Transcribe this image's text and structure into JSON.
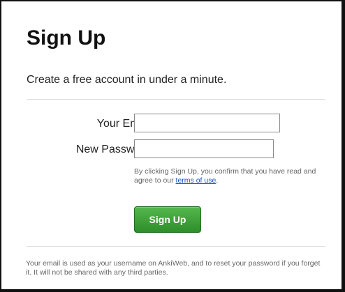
{
  "page": {
    "title": "Sign Up",
    "subtitle": "Create a free account in under a minute."
  },
  "form": {
    "email": {
      "label": "Your Email:",
      "value": "",
      "placeholder": ""
    },
    "password": {
      "label": "New Password:",
      "value": "",
      "placeholder": ""
    },
    "consent": {
      "text_before_link": "By clicking Sign Up, you confirm that you have read and agree to our ",
      "link_text": "terms of use",
      "text_after_link": "."
    },
    "submit_label": "Sign Up"
  },
  "footer": {
    "note": "Your email is used as your username on AnkiWeb, and to reset your password if you forget it. It will not be shared with any third parties."
  },
  "colors": {
    "button_green": "#3aa535",
    "link_blue": "#1a4fc7"
  }
}
